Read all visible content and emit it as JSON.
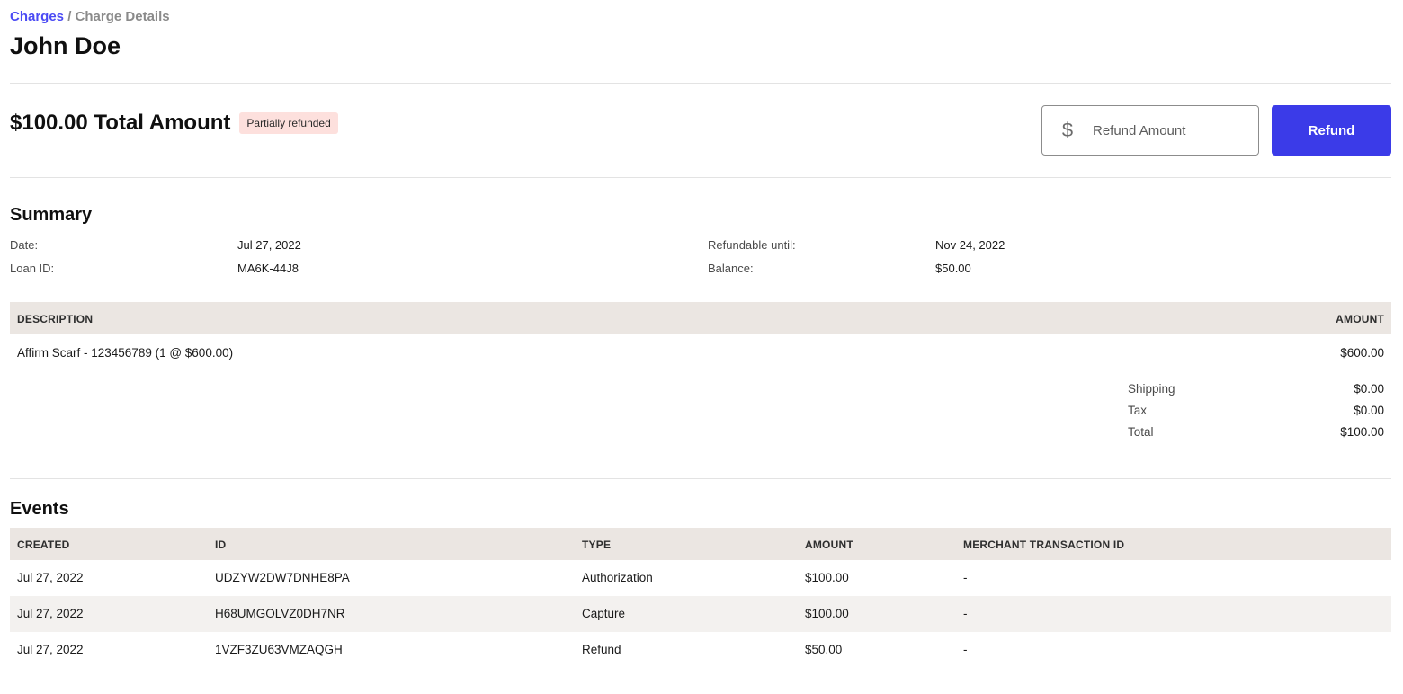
{
  "breadcrumb": {
    "parent": "Charges",
    "separator": " / ",
    "current": "Charge Details"
  },
  "page_title": "John Doe",
  "charge": {
    "total_amount": "$100.00 Total Amount",
    "status": "Partially refunded"
  },
  "refund": {
    "currency_symbol": "$",
    "input_placeholder": "Refund Amount",
    "input_value": "",
    "button_label": "Refund"
  },
  "summary": {
    "title": "Summary",
    "date_label": "Date:",
    "date_value": "Jul 27, 2022",
    "loan_label": "Loan ID:",
    "loan_value": "MA6K-44J8",
    "refundable_label": "Refundable until:",
    "refundable_value": "Nov 24, 2022",
    "balance_label": "Balance:",
    "balance_value": "$50.00"
  },
  "items_table": {
    "headers": [
      "DESCRIPTION",
      "AMOUNT"
    ],
    "rows": [
      {
        "description": "Affirm Scarf - 123456789 (1 @ $600.00)",
        "amount": "$600.00"
      }
    ],
    "totals": [
      {
        "label": "Shipping",
        "value": "$0.00"
      },
      {
        "label": "Tax",
        "value": "$0.00"
      },
      {
        "label": "Total",
        "value": "$100.00"
      }
    ]
  },
  "events": {
    "title": "Events",
    "headers": [
      "CREATED",
      "ID",
      "TYPE",
      "AMOUNT",
      "MERCHANT TRANSACTION ID"
    ],
    "rows": [
      {
        "created": "Jul 27, 2022",
        "id": "UDZYW2DW7DNHE8PA",
        "type": "Authorization",
        "amount": "$100.00",
        "merchant_id": "-"
      },
      {
        "created": "Jul 27, 2022",
        "id": "H68UMGOLVZ0DH7NR",
        "type": "Capture",
        "amount": "$100.00",
        "merchant_id": "-"
      },
      {
        "created": "Jul 27, 2022",
        "id": "1VZF3ZU63VMZAQGH",
        "type": "Refund",
        "amount": "$50.00",
        "merchant_id": "-"
      }
    ]
  },
  "colors": {
    "accent": "#3b3be8",
    "link": "#4a4af4",
    "badge_bg": "#fde0dd",
    "table_header_bg": "#ebe6e2"
  }
}
